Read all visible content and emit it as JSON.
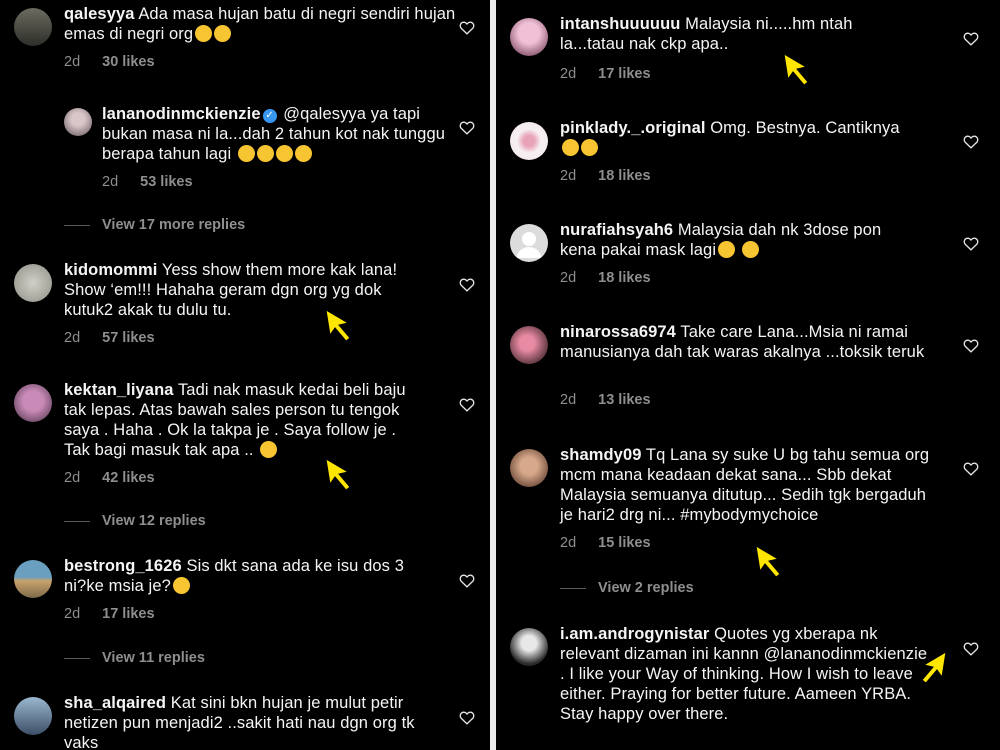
{
  "left": {
    "comments": [
      {
        "username": "qalesyya",
        "text": "Ada masa hujan batu di negri sendiri hujan emas di negri org",
        "age": "2d",
        "likes": "30 likes",
        "emojis": [
          "laugh-cry-emoji",
          "laugh-cry-emoji"
        ]
      },
      {
        "username": "lananodinmckienzie",
        "mention": "@qalesyya",
        "text": "ya tapi bukan masa ni la...dah 2 tahun kot nak tunggu berapa tahun lagi",
        "age": "2d",
        "likes": "53 likes",
        "emojis": [
          "laugh-cry-emoji",
          "laugh-cry-emoji",
          "laugh-cry-emoji",
          "laugh-cry-emoji"
        ]
      },
      {
        "username": "kidomommi",
        "text": "Yess show them more kak lana! Show ‘em!!! Hahaha geram dgn org yg dok kutuk2 akak tu dulu tu.",
        "age": "2d",
        "likes": "57 likes"
      },
      {
        "username": "kektan_liyana",
        "text": "Tadi nak masuk kedai beli baju tak lepas. Atas bawah sales person tu tengok saya . Haha . Ok la takpa je . Saya follow je . Tak bagi masuk tak apa ..",
        "age": "2d",
        "likes": "42 likes",
        "emojis": [
          "shush-emoji"
        ]
      },
      {
        "username": "bestrong_1626",
        "text": "Sis dkt sana ada ke isu dos 3 ni?ke msia je?",
        "age": "2d",
        "likes": "17 likes",
        "emojis": [
          "sad-emoji"
        ]
      },
      {
        "username": "sha_alqaired",
        "text": "Kat sini bkn hujan je mulut petir netizen pun menjadi2 ..sakit hati nau dgn org tk vaks"
      }
    ],
    "view_replies": [
      "View 17 more replies",
      "View 12 replies",
      "View 11 replies"
    ]
  },
  "right": {
    "comments": [
      {
        "username": "intanshuuuuuu",
        "text": "Malaysia ni.....hm ntah la...tatau nak ckp apa..",
        "age": "2d",
        "likes": "17 likes"
      },
      {
        "username": "pinklady._.original",
        "text": "Omg. Bestnya. Cantiknya",
        "age": "2d",
        "likes": "18 likes",
        "emojis": [
          "heart-eyes-emoji",
          "heart-eyes-emoji"
        ]
      },
      {
        "username": "nurafiahsyah6",
        "text": "Malaysia dah nk 3dose pon kena pakai mask lagi",
        "age": "2d",
        "likes": "18 likes",
        "emojis": [
          "rofl-emoji",
          "rofl-emoji"
        ]
      },
      {
        "username": "ninarossa6974",
        "text": "Take care Lana...Msia ni ramai manusianya dah tak waras akalnya ...toksik teruk",
        "age": "2d",
        "likes": "13 likes"
      },
      {
        "username": "shamdy09",
        "text": "Tq Lana sy suke U bg tahu semua org mcm mana keadaan dekat sana... Sbb dekat Malaysia semuanya ditutup... Sedih tgk bergaduh je hari2 drg ni... #mybodymychoice",
        "age": "2d",
        "likes": "15 likes"
      },
      {
        "username": "i.am.androgynistar",
        "text": "Quotes yg xberapa nk relevant dizaman ini kannn @lananodinmckienzie . I like your Way of thinking. How I wish to leave either. Praying for better future. Aameen YRBA. Stay happy over there."
      }
    ],
    "view_replies": [
      "View 2 replies"
    ]
  },
  "colors": {
    "background": "#000000",
    "text": "#f5f5f5",
    "meta": "#8e8e8e",
    "arrow": "#ffe600",
    "verified": "#3797f0"
  }
}
